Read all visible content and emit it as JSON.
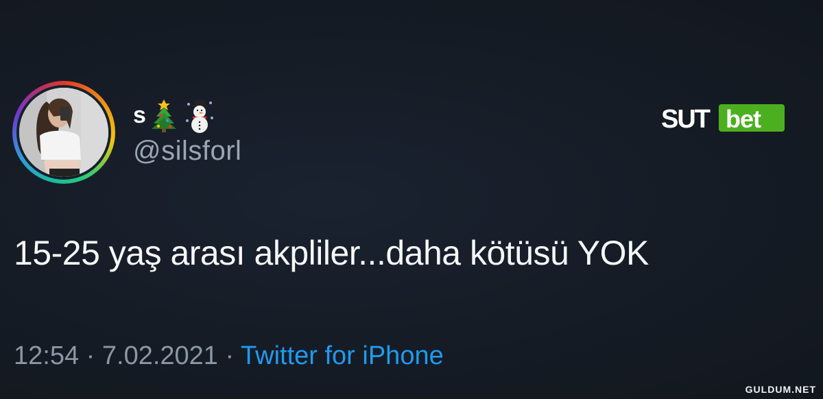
{
  "tweet": {
    "display_name": "s",
    "display_name_emojis": [
      "christmas-tree",
      "snowman"
    ],
    "handle": "@silsforl",
    "text": "15-25 yaş arası akpliler...daha kötüsü YOK",
    "time": "12:54",
    "separator": "·",
    "date": "7.02.2021",
    "source": "Twitter for iPhone"
  },
  "logo": {
    "part1": "SUT",
    "part2": "bet"
  },
  "watermark": "GULDUM.NET",
  "colors": {
    "background": "#15202b",
    "source_link": "#1d9bf0",
    "secondary_text": "#8b98a5",
    "logo_green": "#4caf1f"
  }
}
